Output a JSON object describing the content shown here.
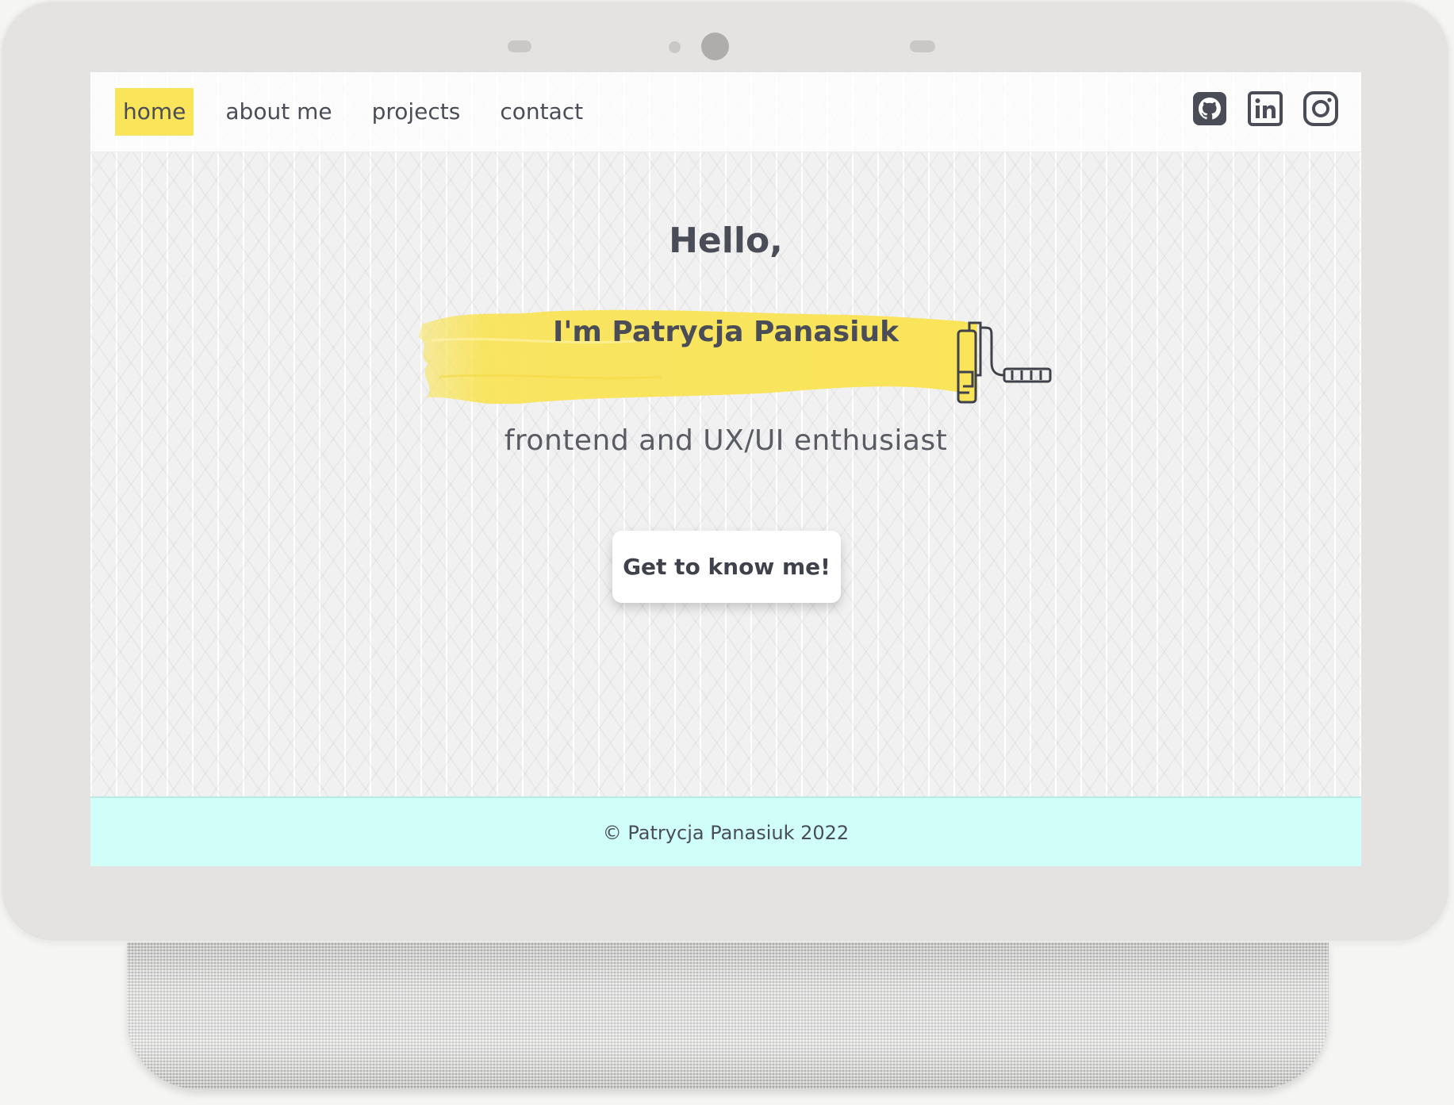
{
  "nav": {
    "links": [
      {
        "label": "home",
        "active": true
      },
      {
        "label": "about me",
        "active": false
      },
      {
        "label": "projects",
        "active": false
      },
      {
        "label": "contact",
        "active": false
      }
    ],
    "socials": [
      "github-icon",
      "linkedin-icon",
      "instagram-icon"
    ]
  },
  "hero": {
    "greeting": "Hello,",
    "name": "I'm Patrycja Panasiuk",
    "tagline": "frontend and UX/UI enthusiast",
    "cta_label": "Get to know me!"
  },
  "footer": {
    "copyright": "© Patrycja Panasiuk 2022"
  },
  "colors": {
    "accent_yellow": "#f9e45a",
    "footer_bg": "#cffff8",
    "text": "#4a4d57"
  }
}
